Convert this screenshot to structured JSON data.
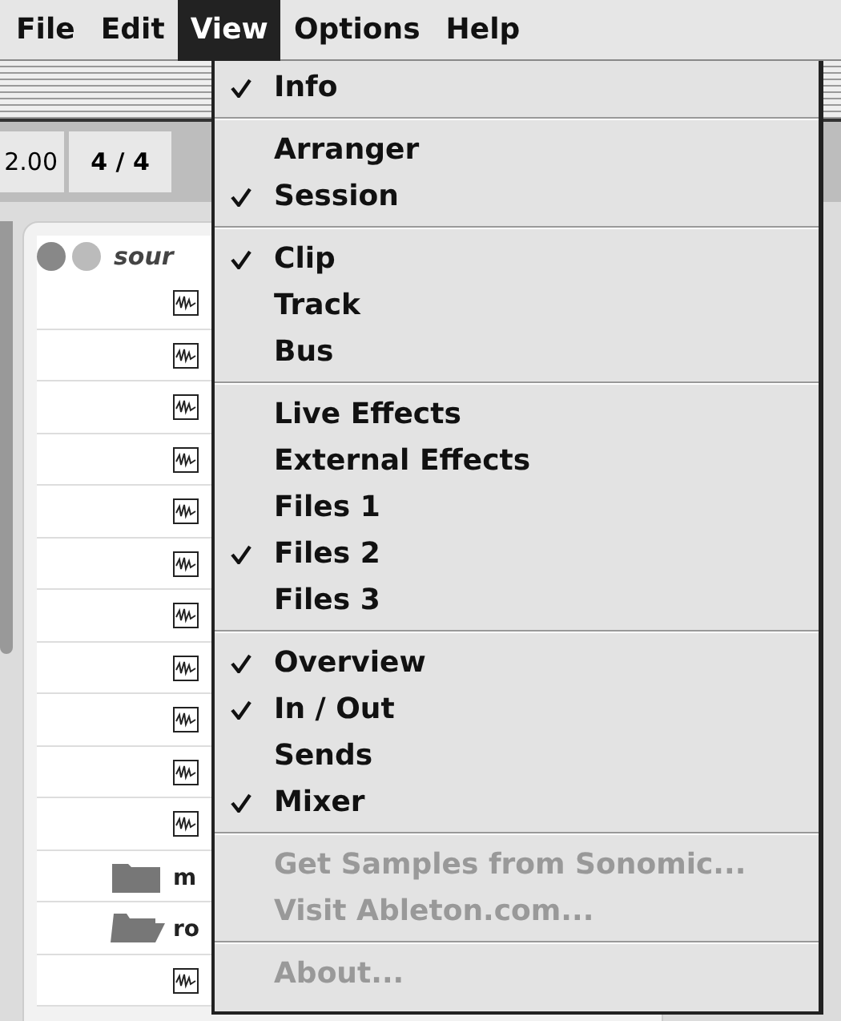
{
  "menu_bar": [
    {
      "label": "File",
      "selected": false
    },
    {
      "label": "Edit",
      "selected": false
    },
    {
      "label": "View",
      "selected": true
    },
    {
      "label": "Options",
      "selected": false
    },
    {
      "label": "Help",
      "selected": false
    }
  ],
  "toolbar": {
    "tempo": "2.00",
    "time_signature": "4 / 4"
  },
  "browser": {
    "path": "sour",
    "rows": [
      {
        "kind": "sample"
      },
      {
        "kind": "sample"
      },
      {
        "kind": "sample"
      },
      {
        "kind": "sample"
      },
      {
        "kind": "sample"
      },
      {
        "kind": "sample"
      },
      {
        "kind": "sample"
      },
      {
        "kind": "sample"
      },
      {
        "kind": "sample"
      },
      {
        "kind": "sample"
      },
      {
        "kind": "sample"
      },
      {
        "kind": "folder",
        "name": "m",
        "expanded": false
      },
      {
        "kind": "folder",
        "name": "ro",
        "expanded": true
      },
      {
        "kind": "sample"
      }
    ]
  },
  "view_menu": {
    "groups": [
      [
        {
          "label": "Info",
          "checked": true,
          "disabled": false
        }
      ],
      [
        {
          "label": "Arranger",
          "checked": false,
          "disabled": false
        },
        {
          "label": "Session",
          "checked": true,
          "disabled": false
        }
      ],
      [
        {
          "label": "Clip",
          "checked": true,
          "disabled": false
        },
        {
          "label": "Track",
          "checked": false,
          "disabled": false
        },
        {
          "label": "Bus",
          "checked": false,
          "disabled": false
        }
      ],
      [
        {
          "label": "Live Effects",
          "checked": false,
          "disabled": false
        },
        {
          "label": "External Effects",
          "checked": false,
          "disabled": false
        },
        {
          "label": "Files 1",
          "checked": false,
          "disabled": false
        },
        {
          "label": "Files 2",
          "checked": true,
          "disabled": false
        },
        {
          "label": "Files 3",
          "checked": false,
          "disabled": false
        }
      ],
      [
        {
          "label": "Overview",
          "checked": true,
          "disabled": false
        },
        {
          "label": "In / Out",
          "checked": true,
          "disabled": false
        },
        {
          "label": "Sends",
          "checked": false,
          "disabled": false
        },
        {
          "label": "Mixer",
          "checked": true,
          "disabled": false
        }
      ],
      [
        {
          "label": "Get Samples from Sonomic...",
          "checked": false,
          "disabled": true
        },
        {
          "label": "Visit Ableton.com...",
          "checked": false,
          "disabled": true
        }
      ],
      [
        {
          "label": "About...",
          "checked": false,
          "disabled": true
        }
      ]
    ]
  }
}
